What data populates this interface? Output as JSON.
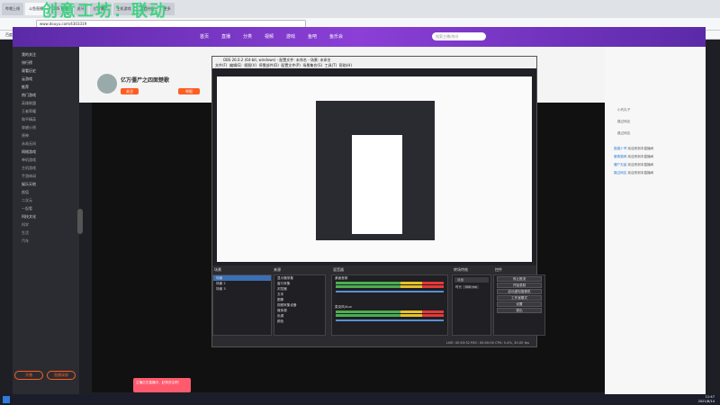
{
  "overlay": {
    "watermark": "创意工坊：联动"
  },
  "browser": {
    "tabs": [
      "哔哩上线",
      "斗鱼直播",
      "OBS 直播",
      "虎牙",
      "亿万僵尸",
      "主机游戏",
      "游戏社区",
      "更多"
    ],
    "address": "www.douyu.com/4303319",
    "bookmarks": [
      "百度",
      "斗鱼",
      "虎牙",
      "B站",
      "淘宝",
      "京东",
      "微博",
      "知乎"
    ]
  },
  "site": {
    "nav": [
      "首页",
      "直播",
      "分类",
      "视频",
      "游戏",
      "鱼吧",
      "鱼乐会"
    ],
    "search_placeholder": "搜索主播/房间",
    "open_app": "PC客户端"
  },
  "sidebar": {
    "items": [
      "我的关注",
      "排行榜",
      "观看历史",
      "云游戏",
      "推荐",
      "热门游戏",
      "英雄联盟",
      "王者荣耀",
      "和平精英",
      "穿越火线",
      "原神",
      "永劫无间",
      "网络游戏",
      "单机游戏",
      "主机游戏",
      "手游休闲",
      "娱乐天地",
      "颜值",
      "二次元",
      "一起看",
      "科技文化",
      "科学",
      "生活",
      "汽车"
    ],
    "btn1": "开播",
    "btn2": "直播录屏"
  },
  "room": {
    "title": "亿万僵尸之四面楚歌",
    "follow": "关注",
    "report": "举报"
  },
  "obs": {
    "title": "OBS 26.0.2 (64-bit, windows) - 配置文件: 未命名 - 场景: 未命名",
    "menu": [
      "文件(F)",
      "编辑(E)",
      "视图(V)",
      "停靠部件(D)",
      "配置文件(P)",
      "场景集合(S)",
      "工具(T)",
      "帮助(H)"
    ],
    "docks": {
      "scenes": {
        "title": "场景",
        "items": [
          "场景",
          "场景 2",
          "场景 3"
        ]
      },
      "sources": {
        "title": "来源",
        "items": [
          "显示器采集",
          "窗口采集",
          "浏览器",
          "文本",
          "图像",
          "视频采集设备",
          "媒体源",
          "色源",
          "颜色"
        ]
      },
      "mixer": {
        "title": "混音器",
        "items": [
          "桌面音频",
          "麦克风/Aux"
        ]
      },
      "transitions": {
        "title": "转场特效",
        "type": "淡出",
        "duration_label": "时长",
        "duration": "300 ms"
      },
      "controls": {
        "title": "控件",
        "buttons": [
          "停止推流",
          "开始录制",
          "启动虚拟摄像机",
          "工作室模式",
          "设置",
          "退出"
        ]
      }
    },
    "status": "LIVE: 00:03:52   REC: 00:00:00   CPU: 5.4%, 30.00 fps"
  },
  "chat": {
    "ranks": [
      "小灼丸子",
      "路过网友",
      "路过网友"
    ],
    "messages": [
      {
        "name": "猫猫少爷",
        "text": "欢迎来到本直播间"
      },
      {
        "name": "鹿角猫咪",
        "text": "欢迎来到本直播间"
      },
      {
        "name": "僵尸无敌",
        "text": "欢迎来到本直播间"
      },
      {
        "name": "路过网友",
        "text": "欢迎来到本直播间"
      }
    ]
  },
  "banner": {
    "text": "主播正在直播中，赶快关注吧！"
  },
  "clock": {
    "time": "11:47",
    "date": "2021/8/14"
  }
}
